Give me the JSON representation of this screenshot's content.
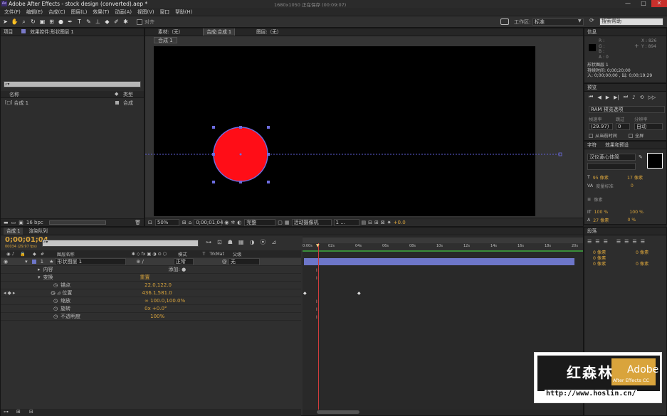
{
  "window": {
    "title": "Adobe After Effects - stock design (converted).aep *",
    "center_info": "1680x1050  正在保存 (00:09:07)",
    "min": "—",
    "max": "□",
    "close": "✕"
  },
  "menu": [
    "文件(F)",
    "编辑(E)",
    "合成(C)",
    "图层(L)",
    "效果(T)",
    "动画(A)",
    "视图(V)",
    "窗口",
    "帮助(H)"
  ],
  "toolbar": {
    "align_label": "对齐",
    "workspace_label": "工作区:",
    "workspace_value": "标准",
    "search_placeholder": "搜索帮助"
  },
  "project": {
    "tab1": "项目",
    "tab2": "效果控件:形状图层 1",
    "col_name": "名称",
    "col_type": "类型",
    "item_name": "合成 1",
    "item_type": "合成",
    "bpc": "16 bpc"
  },
  "composition": {
    "tabs": [
      "素材:（无）",
      "合成:合成 1",
      "图层:（无）"
    ],
    "subtab": "合成 1",
    "status": {
      "zoom": "50%",
      "timecode": "0;00;01;04",
      "resolution": "完整",
      "camera": "活动摄像机",
      "views": "1 ...",
      "exposure": "+0.0"
    }
  },
  "info": {
    "title": "信息",
    "r": "R :",
    "g": "G :",
    "b": "B :",
    "a": "A : 0",
    "x": "X : 826",
    "y": "Y : 894",
    "layer": "形状图层 1",
    "dur": "持续时间: 0;00;20;00",
    "io": "入: 0;00;00;00 , 出: 0;00;19;29"
  },
  "preview": {
    "title": "预览",
    "ram": "RAM 预览选项",
    "fps_label": "帧速率",
    "skip_label": "跳过",
    "res_label": "分辨率",
    "fps": "(29.97)",
    "skip": "0",
    "res": "自动",
    "from_now": "从当前时间",
    "full": "全屏"
  },
  "character": {
    "title": "字符",
    "tab2": "效果和预设",
    "font": "汉仪菱心体简",
    "size": "95 像素",
    "leading": "17 像素",
    "tracking": "0",
    "kerning": "度量标准",
    "indent": "像素",
    "vscale": "100 %",
    "hscale": "100 %",
    "baseline": "27 像素",
    "tsume": "0 %"
  },
  "paragraph": {
    "title": "段落",
    "v1": "0 像素",
    "v2": "0 像素",
    "v3": "0 像素",
    "v4": "0 像素",
    "v5": "0 像素"
  },
  "timeline": {
    "tab": "合成 1",
    "tab2": "渲染队列",
    "timecode": "0;00;01;04",
    "fps": "00034 (29.97 fps)",
    "headers": {
      "name": "图层名称",
      "mode": "模式",
      "t": "T",
      "trkmat": "TrkMat",
      "parent": "父级"
    },
    "layer": {
      "num": "1",
      "name": "形状图层 1",
      "mode": "正常",
      "parent": "无"
    },
    "props": [
      {
        "name": "内容",
        "value": "",
        "add": "添加: ●"
      },
      {
        "name": "变换",
        "value": "重置"
      },
      {
        "name": "锚点",
        "value": "22.0,122.0"
      },
      {
        "name": "位置",
        "value": "436.1,581.0"
      },
      {
        "name": "缩放",
        "value": "∞ 100.0,100.0%"
      },
      {
        "name": "旋转",
        "value": "0x +0.0°"
      },
      {
        "name": "不透明度",
        "value": "100%"
      }
    ],
    "ruler": [
      "0:00s",
      "02s",
      "04s",
      "06s",
      "08s",
      "10s",
      "12s",
      "14s",
      "16s",
      "18s",
      "20s"
    ]
  },
  "watermark": {
    "cn": "红森林",
    "adobe": "Adobe",
    "product": "After Effects CC",
    "url": "http://www.hoslin.cn/"
  },
  "colors": {
    "accent": "#d9a43c",
    "circle": "#ff0d17",
    "layerbar": "#6d76c9",
    "playhead": "#d23c3c"
  }
}
